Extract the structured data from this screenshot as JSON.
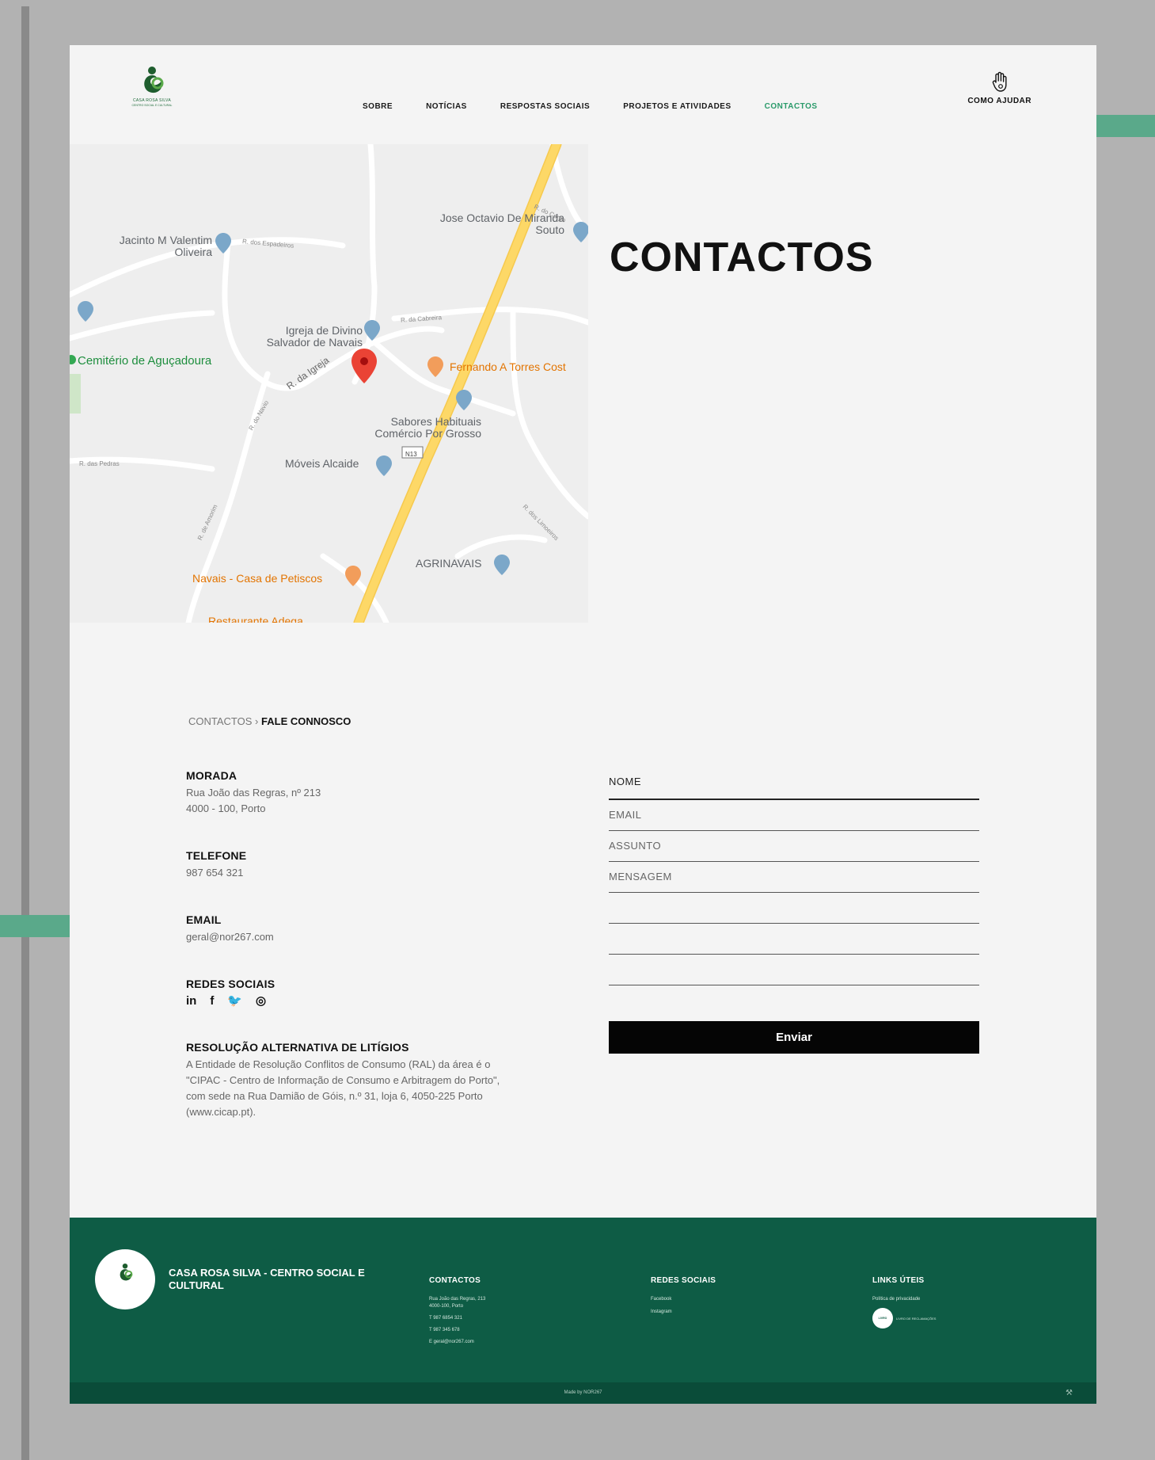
{
  "brand": {
    "logo_text": "CASA ROSA SILVA",
    "logo_sub": "CENTRO SOCIAL E CULTURAL",
    "footer_name": "CASA ROSA SILVA - CENTRO SOCIAL E CULTURAL"
  },
  "nav": {
    "items": [
      {
        "label": "SOBRE",
        "active": false
      },
      {
        "label": "NOTÍCIAS",
        "active": false
      },
      {
        "label": "RESPOSTAS SOCIAIS",
        "active": false
      },
      {
        "label": "PROJETOS E ATIVIDADES",
        "active": false
      },
      {
        "label": "CONTACTOS",
        "active": true
      }
    ],
    "help_label": "COMO AJUDAR",
    "help_icon": "hand-icon"
  },
  "map": {
    "places": [
      "Jose Octavio De Miranda Souto",
      "Jacinto M Valentim Oliveira",
      "Igreja de Divino Salvador de Navais",
      "Cemitério de Aguçadoura",
      "Fernando A Torres Cost",
      "Sabores Habituais Comércio Por Grosso",
      "Móveis Alcaide",
      "AGRINAVAIS",
      "Navais - Casa de Petiscos",
      "Restaurante Adega"
    ],
    "streets": [
      "R. da Igreja",
      "R. dos Espadeiros",
      "R. da Cabreira",
      "R. do Navio",
      "R. do Corgo",
      "R. dos Limoeiros",
      "R. das Pedras",
      "R. de Amorim",
      "N13"
    ],
    "pin_color": "#ea4335",
    "road_color": "#fdd867"
  },
  "page": {
    "title": "CONTACTOS"
  },
  "breadcrumb": {
    "parent": "CONTACTOS",
    "separator": "›",
    "current": "FALE CONNOSCO"
  },
  "contact": {
    "address_title": "MORADA",
    "address_line1": "Rua João das Regras, nº 213",
    "address_line2": "4000 - 100, Porto",
    "phone_title": "TELEFONE",
    "phone": "987 654 321",
    "email_title": "EMAIL",
    "email": "geral@nor267.com",
    "social_title": "REDES SOCIAIS",
    "social_icons": {
      "linkedin": "in",
      "facebook": "f",
      "twitter": "🐦",
      "instagram": "◎"
    },
    "ral_title": "RESOLUÇÃO ALTERNATIVA DE LITÍGIOS",
    "ral_line1": "A Entidade de Resolução Conflitos de Consumo (RAL) da área é o",
    "ral_line2": "\"CIPAC - Centro de Informação de Consumo e Arbitragem do Porto\",",
    "ral_line3": "com sede na Rua Damião de Góis, n.º 31, loja 6, 4050-225 Porto",
    "ral_line4": "(www.cicap.pt)."
  },
  "form": {
    "name_label": "NOME",
    "email_label": "EMAIL",
    "subject_label": "ASSUNTO",
    "message_label": "MENSAGEM",
    "submit_label": "Enviar"
  },
  "footer": {
    "contacts_title": "CONTACTOS",
    "contacts_addr1": "Rua João das Regras, 213",
    "contacts_addr2": "4000-100, Porto",
    "contacts_phone1": "T 987 6854 321",
    "contacts_phone2": "T 987 345 678",
    "contacts_email": "E geral@nor267.com",
    "social_title": "REDES SOCIAIS",
    "social_facebook": "Facebook",
    "social_instagram": "Instagram",
    "links_title": "LINKS ÚTEIS",
    "links_privacy": "Política de privacidade",
    "links_badge": "LIVRO DE RECLAMAÇÕES",
    "made_by": "Made by NOR267"
  },
  "colors": {
    "background": "#b2b2b2",
    "page": "#f4f4f4",
    "accent": "#2a9a6a",
    "footer": "#0e5c45",
    "button": "#050505"
  }
}
